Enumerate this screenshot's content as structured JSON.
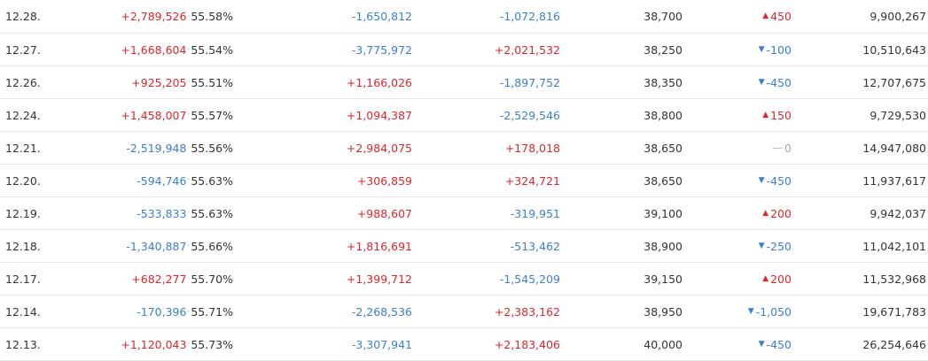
{
  "rows": [
    {
      "date": "12.28.",
      "indiv": "+2,789,526",
      "indiv_dir": "pos",
      "ratio": "55.58%",
      "foreign": "-1,650,812",
      "foreign_dir": "neg",
      "inst": "-1,072,816",
      "inst_dir": "neg",
      "close": "38,700",
      "change": "450",
      "change_dir": "up",
      "volume": "9,900,267"
    },
    {
      "date": "12.27.",
      "indiv": "+1,668,604",
      "indiv_dir": "pos",
      "ratio": "55.54%",
      "foreign": "-3,775,972",
      "foreign_dir": "neg",
      "inst": "+2,021,532",
      "inst_dir": "pos",
      "close": "38,250",
      "change": "-100",
      "change_dir": "down",
      "volume": "10,510,643"
    },
    {
      "date": "12.26.",
      "indiv": "+925,205",
      "indiv_dir": "pos",
      "ratio": "55.51%",
      "foreign": "+1,166,026",
      "foreign_dir": "pos",
      "inst": "-1,897,752",
      "inst_dir": "neg",
      "close": "38,350",
      "change": "-450",
      "change_dir": "down",
      "volume": "12,707,675"
    },
    {
      "date": "12.24.",
      "indiv": "+1,458,007",
      "indiv_dir": "pos",
      "ratio": "55.57%",
      "foreign": "+1,094,387",
      "foreign_dir": "pos",
      "inst": "-2,529,546",
      "inst_dir": "neg",
      "close": "38,800",
      "change": "150",
      "change_dir": "up",
      "volume": "9,729,530"
    },
    {
      "date": "12.21.",
      "indiv": "-2,519,948",
      "indiv_dir": "neg",
      "ratio": "55.56%",
      "foreign": "+2,984,075",
      "foreign_dir": "pos",
      "inst": "+178,018",
      "inst_dir": "pos",
      "close": "38,650",
      "change": "0",
      "change_dir": "flat",
      "volume": "14,947,080"
    },
    {
      "date": "12.20.",
      "indiv": "-594,746",
      "indiv_dir": "neg",
      "ratio": "55.63%",
      "foreign": "+306,859",
      "foreign_dir": "pos",
      "inst": "+324,721",
      "inst_dir": "pos",
      "close": "38,650",
      "change": "-450",
      "change_dir": "down",
      "volume": "11,937,617"
    },
    {
      "date": "12.19.",
      "indiv": "-533,833",
      "indiv_dir": "neg",
      "ratio": "55.63%",
      "foreign": "+988,607",
      "foreign_dir": "pos",
      "inst": "-319,951",
      "inst_dir": "neg",
      "close": "39,100",
      "change": "200",
      "change_dir": "up",
      "volume": "9,942,037"
    },
    {
      "date": "12.18.",
      "indiv": "-1,340,887",
      "indiv_dir": "neg",
      "ratio": "55.66%",
      "foreign": "+1,816,691",
      "foreign_dir": "pos",
      "inst": "-513,462",
      "inst_dir": "neg",
      "close": "38,900",
      "change": "-250",
      "change_dir": "down",
      "volume": "11,042,101"
    },
    {
      "date": "12.17.",
      "indiv": "+682,277",
      "indiv_dir": "pos",
      "ratio": "55.70%",
      "foreign": "+1,399,712",
      "foreign_dir": "pos",
      "inst": "-1,545,209",
      "inst_dir": "neg",
      "close": "39,150",
      "change": "200",
      "change_dir": "up",
      "volume": "11,532,968"
    },
    {
      "date": "12.14.",
      "indiv": "-170,396",
      "indiv_dir": "neg",
      "ratio": "55.71%",
      "foreign": "-2,268,536",
      "foreign_dir": "neg",
      "inst": "+2,383,162",
      "inst_dir": "pos",
      "close": "38,950",
      "change": "-1,050",
      "change_dir": "down",
      "volume": "19,671,783"
    },
    {
      "date": "12.13.",
      "indiv": "+1,120,043",
      "indiv_dir": "pos",
      "ratio": "55.73%",
      "foreign": "-3,307,941",
      "foreign_dir": "neg",
      "inst": "+2,183,406",
      "inst_dir": "pos",
      "close": "40,000",
      "change": "-450",
      "change_dir": "down",
      "volume": "26,254,646"
    }
  ],
  "colors": {
    "up": "#e0262b",
    "down": "#3a7fd4",
    "flat": "#a9a9a9",
    "text": "#333333",
    "grid_line": "#e8e8e8"
  },
  "icons": {
    "up": "triangle-up-icon",
    "down": "triangle-down-icon",
    "flat": "dash-icon"
  }
}
